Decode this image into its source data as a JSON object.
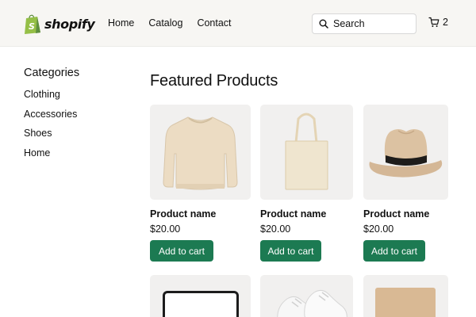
{
  "header": {
    "logo_text": "shopify",
    "nav": [
      "Home",
      "Catalog",
      "Contact"
    ],
    "search_placeholder": "Search",
    "cart_count": "2"
  },
  "sidebar": {
    "title": "Categories",
    "items": [
      "Clothing",
      "Accessories",
      "Shoes",
      "Home"
    ]
  },
  "main": {
    "title": "Featured Products",
    "products": [
      {
        "image": "sweatshirt",
        "name": "Product name",
        "price": "$20.00",
        "button": "Add to cart"
      },
      {
        "image": "tote-bag",
        "name": "Product name",
        "price": "$20.00",
        "button": "Add to cart"
      },
      {
        "image": "fedora-hat",
        "name": "Product name",
        "price": "$20.00",
        "button": "Add to cart"
      }
    ],
    "second_row_images": [
      "tablet",
      "sneakers",
      "notebook"
    ]
  },
  "colors": {
    "brand_green": "#1c7a52",
    "logo_green": "#95bf47",
    "header_bg": "#f7f6f3",
    "card_bg": "#f1f0ef"
  }
}
